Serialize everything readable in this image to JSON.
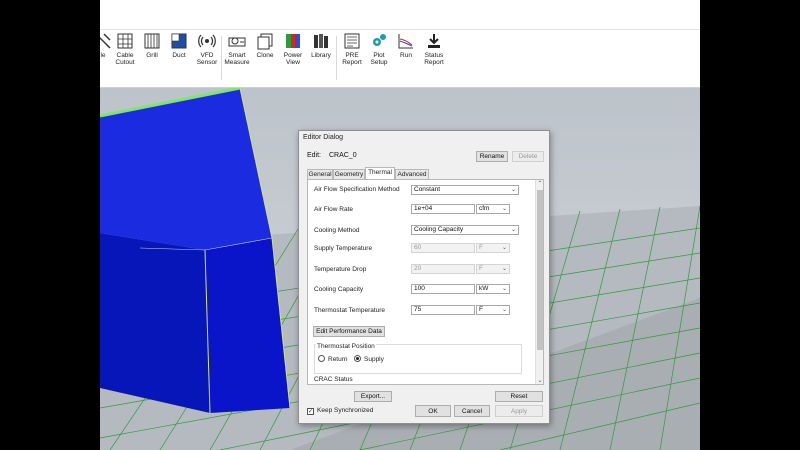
{
  "ribbon": {
    "tools": [
      {
        "label": "le",
        "icon": "partial-icon"
      },
      {
        "label": "Cable\nCutout",
        "icon": "cable-cutout-icon"
      },
      {
        "label": "Grill",
        "icon": "grill-icon"
      },
      {
        "label": "Duct",
        "icon": "duct-icon"
      },
      {
        "label": "VFD\nSensor",
        "icon": "vfd-sensor-icon"
      },
      {
        "label": "Smart\nMeasure",
        "icon": "smart-measure-icon"
      },
      {
        "label": "Clone",
        "icon": "clone-icon"
      },
      {
        "label": "Power\nView",
        "icon": "power-view-icon"
      },
      {
        "label": "Library",
        "icon": "library-icon"
      },
      {
        "label": "PRE\nReport",
        "icon": "pre-report-icon"
      },
      {
        "label": "Plot\nSetup",
        "icon": "plot-setup-icon"
      },
      {
        "label": "Run",
        "icon": "run-icon"
      },
      {
        "label": "Status\nReport",
        "icon": "status-report-icon"
      }
    ]
  },
  "dialog": {
    "title": "Editor Dialog",
    "edit_label": "Edit:",
    "object_name": "CRAC_0",
    "rename_label": "Rename",
    "delete_label": "Delete",
    "tabs": [
      "General",
      "Geometry",
      "Thermal",
      "Advanced"
    ],
    "active_tab": "Thermal",
    "fields": {
      "airflow_method": {
        "label": "Air Flow Specification Method",
        "value": "Constant"
      },
      "airflow_rate": {
        "label": "Air Flow Rate",
        "value": "1e+04",
        "unit": "cfm"
      },
      "cooling_method": {
        "label": "Cooling Method",
        "value": "Cooling Capacity"
      },
      "supply_temp": {
        "label": "Supply Temperature",
        "value": "60",
        "unit": "F"
      },
      "temp_drop": {
        "label": "Temperature Drop",
        "value": "20",
        "unit": "F"
      },
      "cooling_capacity": {
        "label": "Cooling Capacity",
        "value": "100",
        "unit": "kW"
      },
      "thermostat_temp": {
        "label": "Thermostat Temperature",
        "value": "75",
        "unit": "F"
      }
    },
    "edit_perf_label": "Edit Performance Data",
    "thermostat_position": {
      "label": "Thermostat Position",
      "options": [
        "Return",
        "Supply"
      ],
      "selected": "Supply"
    },
    "crac_status_label": "CRAC Status",
    "export_label": "Export...",
    "reset_label": "Reset",
    "keep_sync_label": "Keep Synchronized",
    "ok_label": "OK",
    "cancel_label": "Cancel",
    "apply_label": "Apply"
  },
  "colors": {
    "crac_body": "#0a14c8",
    "grid_line": "#2f9c3a",
    "selection_outline": "#d8e85a"
  }
}
